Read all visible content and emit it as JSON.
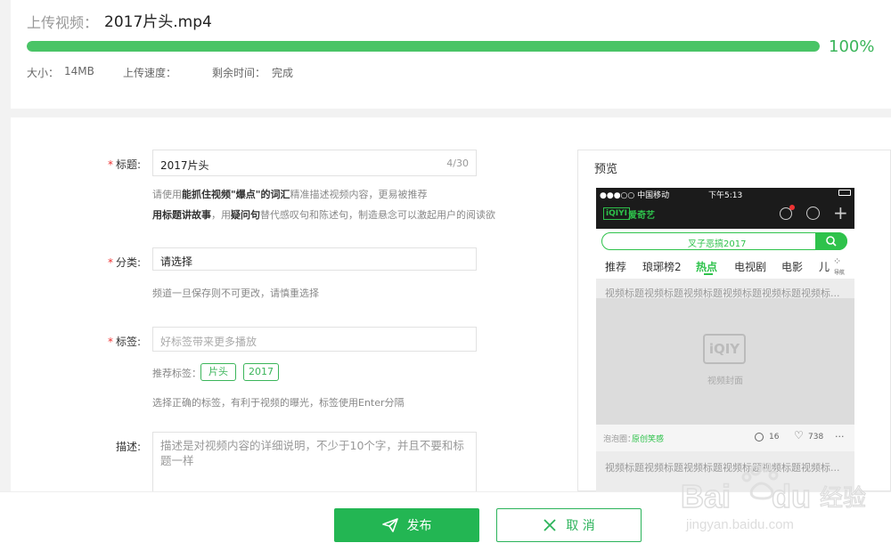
{
  "upload": {
    "label": "上传视频：",
    "filename": "2017片头.mp4",
    "progress_percent": 100,
    "progress_text": "100%",
    "size_label": "大小：",
    "size_value": "14MB",
    "speed_label": "上传速度：",
    "remaining_label": "剩余时间：",
    "remaining_value": "完成"
  },
  "form": {
    "title": {
      "label": "标题:",
      "value": "2017片头",
      "counter": "4/30",
      "hint1_pre": "请使用",
      "hint1_bold": "能抓住视频\"爆点\"的词汇",
      "hint1_post": "精准描述视频内容，更易被推荐",
      "hint2_bold1": "用标题讲故事",
      "hint2_mid": "，用",
      "hint2_bold2": "疑问句",
      "hint2_post": "替代感叹句和陈述句，制造悬念可以激起用户的阅读欲"
    },
    "category": {
      "label": "分类:",
      "value": "请选择",
      "hint": "频道一旦保存则不可更改，请慎重选择"
    },
    "tags": {
      "label": "标签:",
      "placeholder": "好标签带来更多播放",
      "recommend_label": "推荐标签：",
      "recommended": [
        "片头",
        "2017"
      ],
      "hint": "选择正确的标签，有利于视频的曝光，标签使用Enter分隔"
    },
    "description": {
      "label": "描述:",
      "placeholder": "描述是对视频内容的详细说明，不少于10个字，并且不要和标题一样"
    }
  },
  "preview": {
    "heading": "预览",
    "status_carrier": "●●●○○ 中国移动",
    "status_time": "下午5:13",
    "app_name": "爱奇艺",
    "search_text": "叉子恶搞2017",
    "tabs": [
      "推荐",
      "琅琊榜2",
      "热点",
      "电视剧",
      "电影",
      "儿"
    ],
    "active_tab": "热点",
    "nav_label": "导航",
    "video_title": "视频标题视频标题视频标题视频标题视频标题视频标...",
    "cover_label": "视频封面",
    "source_prefix": "泡泡圈：",
    "source_name": "原创笑感",
    "comment_count": "16",
    "like_count": "738",
    "more": "···"
  },
  "actions": {
    "publish": "发布",
    "cancel": "取 消"
  },
  "colors": {
    "accent": "#23b653",
    "progress": "#49c466"
  }
}
